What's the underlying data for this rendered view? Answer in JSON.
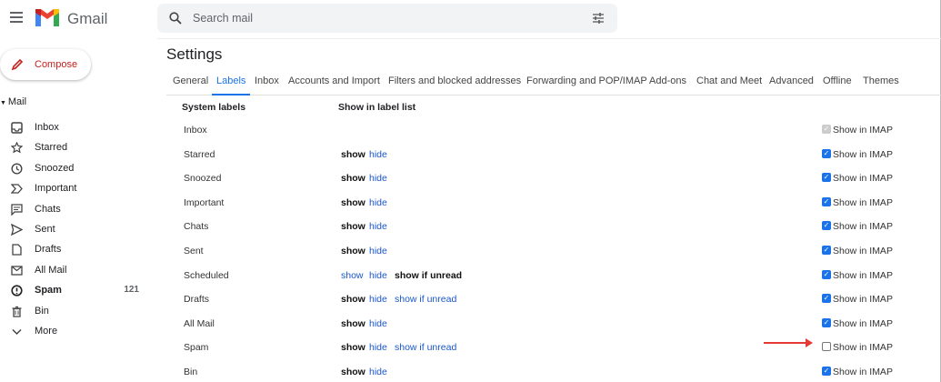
{
  "app": {
    "name": "Gmail",
    "search_placeholder": "Search mail"
  },
  "compose": "Compose",
  "sidebar": {
    "section": "Mail",
    "items": [
      {
        "label": "Inbox",
        "icon": "inbox-icon"
      },
      {
        "label": "Starred",
        "icon": "star-icon"
      },
      {
        "label": "Snoozed",
        "icon": "clock-icon"
      },
      {
        "label": "Important",
        "icon": "important-icon"
      },
      {
        "label": "Chats",
        "icon": "chat-icon"
      },
      {
        "label": "Sent",
        "icon": "send-icon"
      },
      {
        "label": "Drafts",
        "icon": "draft-icon"
      },
      {
        "label": "All Mail",
        "icon": "mail-icon"
      },
      {
        "label": "Spam",
        "icon": "spam-icon",
        "count": "121",
        "bold": true
      },
      {
        "label": "Bin",
        "icon": "trash-icon"
      },
      {
        "label": "More",
        "icon": "chevron-down-icon"
      }
    ]
  },
  "settings": {
    "title": "Settings",
    "tabs": [
      "General",
      "Labels",
      "Inbox",
      "Accounts and Import",
      "Filters and blocked addresses",
      "Forwarding and POP/IMAP",
      "Add-ons",
      "Chat and Meet",
      "Advanced",
      "Offline",
      "Themes"
    ],
    "active_tab": "Labels",
    "col_system": "System labels",
    "col_show": "Show in label list",
    "imap_label": "Show in IMAP",
    "rows": [
      {
        "name": "Inbox",
        "opts": [],
        "imap": "disabled-checked"
      },
      {
        "name": "Starred",
        "opts": [
          "show",
          "hide"
        ],
        "selected": "show",
        "imap": "checked"
      },
      {
        "name": "Snoozed",
        "opts": [
          "show",
          "hide"
        ],
        "selected": "show",
        "imap": "checked"
      },
      {
        "name": "Important",
        "opts": [
          "show",
          "hide"
        ],
        "selected": "show",
        "imap": "checked"
      },
      {
        "name": "Chats",
        "opts": [
          "show",
          "hide"
        ],
        "selected": "show",
        "imap": "checked"
      },
      {
        "name": "Sent",
        "opts": [
          "show",
          "hide"
        ],
        "selected": "show",
        "imap": "checked"
      },
      {
        "name": "Scheduled",
        "opts": [
          "show",
          "hide",
          "show if unread"
        ],
        "selected": "show if unread",
        "imap": "checked"
      },
      {
        "name": "Drafts",
        "opts": [
          "show",
          "hide",
          "show if unread"
        ],
        "selected": "show",
        "imap": "checked"
      },
      {
        "name": "All Mail",
        "opts": [
          "show",
          "hide"
        ],
        "selected": "show",
        "imap": "checked"
      },
      {
        "name": "Spam",
        "opts": [
          "show",
          "hide",
          "show if unread"
        ],
        "selected": "show",
        "imap": "unchecked"
      },
      {
        "name": "Bin",
        "opts": [
          "show",
          "hide"
        ],
        "selected": "show",
        "imap": "checked"
      }
    ]
  },
  "annotation": {
    "arrow_color": "#e53935",
    "points_to": "Spam Show in IMAP"
  }
}
